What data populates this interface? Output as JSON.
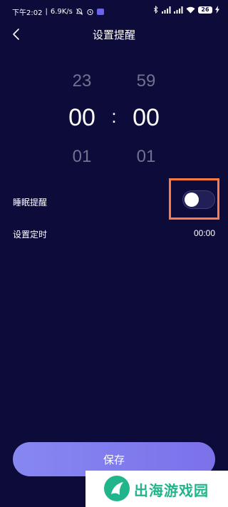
{
  "status_bar": {
    "time": "下午2:02",
    "network_speed": "6.9K/s",
    "icons": [
      "mute-icon",
      "alarm-icon",
      "chat-icon",
      "bluetooth-icon",
      "signal-icon",
      "signal-icon",
      "wifi-icon",
      "battery-icon",
      "charging-icon"
    ],
    "battery": "26"
  },
  "header": {
    "title": "设置提醒",
    "back_icon": "chevron-left-icon"
  },
  "time_picker": {
    "hours": {
      "prev": "23",
      "selected": "00",
      "next": "01"
    },
    "minutes": {
      "prev": "59",
      "selected": "00",
      "next": "01"
    },
    "separator": ":"
  },
  "settings": {
    "sleep_reminder": {
      "label": "睡眠提醒",
      "enabled": false
    },
    "set_timer": {
      "label": "设置定时",
      "value": "00:00"
    }
  },
  "save_button": {
    "label": "保存"
  },
  "watermark": {
    "text": "出海游戏园"
  },
  "colors": {
    "background": "#0d0b3a",
    "accent": "#8787f2",
    "highlight": "#ff7a45",
    "watermark_green": "#20b58a"
  }
}
